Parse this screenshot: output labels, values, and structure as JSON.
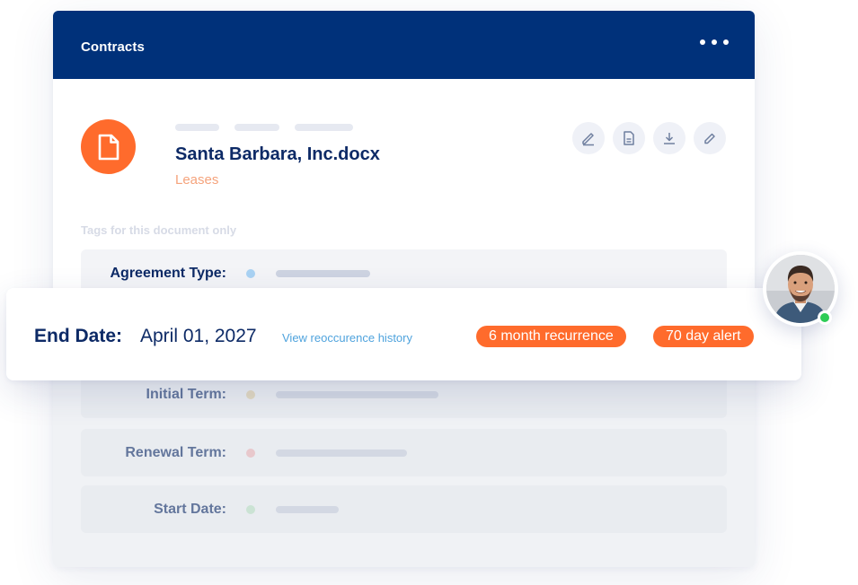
{
  "header": {
    "title": "Contracts",
    "more_icon": "more-horizontal-icon"
  },
  "document": {
    "name": "Santa Barbara, Inc.docx",
    "category": "Leases",
    "icon": "document-icon",
    "actions": [
      "edit-icon",
      "file-text-icon",
      "download-icon",
      "pencil-icon"
    ]
  },
  "tags_label": "Tags for this document only",
  "fields": [
    {
      "label": "Agreement Type:",
      "dot_color": "#a9d2f3",
      "bar_fill": 0.55
    },
    {
      "label": "Initial Term:",
      "dot_color": "#e6d3a6",
      "bar_fill": 0.95
    },
    {
      "label": "Renewal Term:",
      "dot_color": "#f1b7b8",
      "bar_fill": 0.77
    },
    {
      "label": "Start Date:",
      "dot_color": "#bfe5c6",
      "bar_fill": 0.37
    }
  ],
  "end_date": {
    "label": "End Date:",
    "value": "April 01, 2027",
    "history_link": "View reoccurence history",
    "badges": [
      "6 month recurrence",
      "70 day alert"
    ]
  },
  "colors": {
    "header_bg": "#00317a",
    "accent": "#ff6b2c",
    "text_primary": "#0d2a66",
    "link": "#4fa3dd",
    "online": "#2ecc56"
  }
}
